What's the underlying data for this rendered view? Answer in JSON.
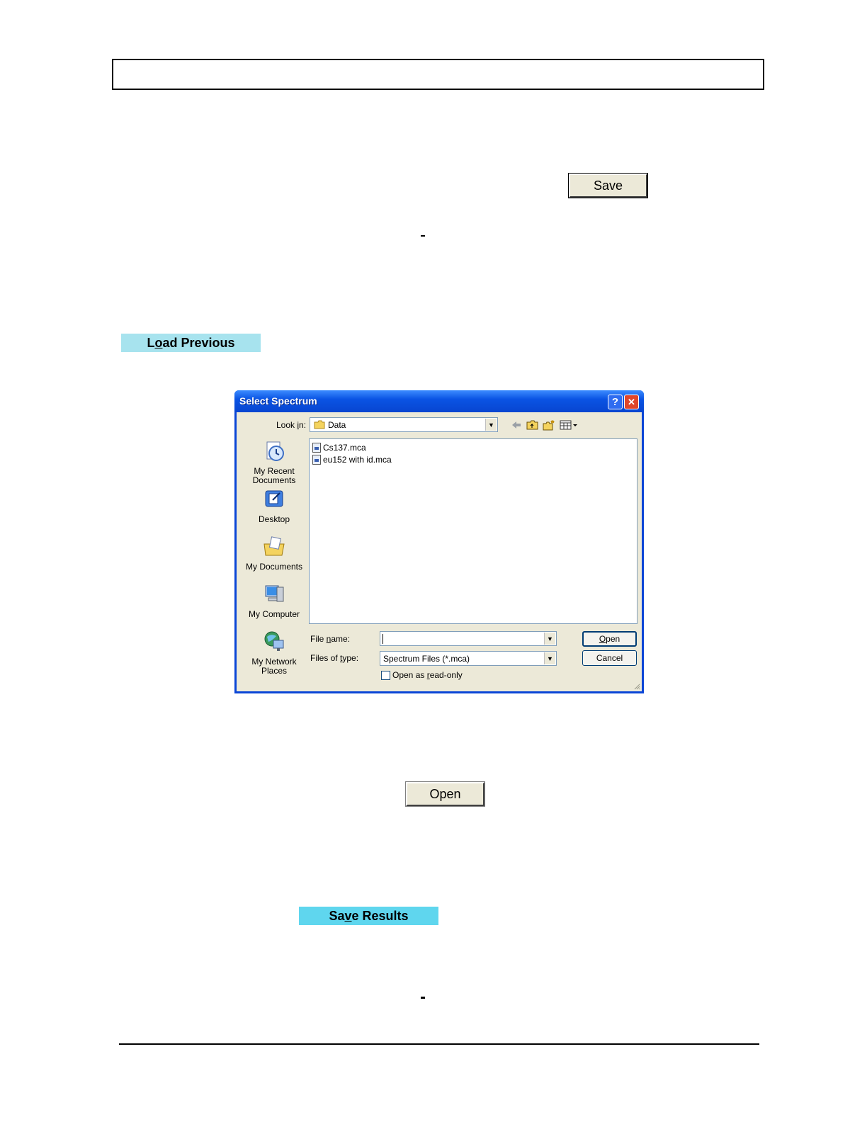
{
  "doc": {
    "save_button_label": "Save",
    "load_previous_label_pre": "L",
    "load_previous_label_ul": "o",
    "load_previous_label_post": "ad Previous",
    "open_button_label": "Open",
    "save_results_label_pre": "Sa",
    "save_results_label_ul": "v",
    "save_results_label_post": "e Results"
  },
  "dialog": {
    "title": "Select Spectrum",
    "help_glyph": "?",
    "close_glyph": "✕",
    "look_in_label_pre": "Look ",
    "look_in_label_ul": "i",
    "look_in_label_post": "n:",
    "look_in_value": "Data",
    "places": [
      {
        "label_line1": "My Recent",
        "label_line2": "Documents"
      },
      {
        "label_line1": "Desktop",
        "label_line2": ""
      },
      {
        "label_line1": "My Documents",
        "label_line2": ""
      },
      {
        "label_line1": "My Computer",
        "label_line2": ""
      },
      {
        "label_line1": "My Network",
        "label_line2": "Places"
      }
    ],
    "files": [
      "Cs137.mca",
      "eu152 with id.mca"
    ],
    "file_name_label_pre": "File ",
    "file_name_label_ul": "n",
    "file_name_label_post": "ame:",
    "file_name_value": "",
    "files_of_type_label_pre": "Files of ",
    "files_of_type_label_ul": "t",
    "files_of_type_label_post": "ype:",
    "files_of_type_value": "Spectrum Files (*.mca)",
    "read_only_label_pre": "Open as ",
    "read_only_label_ul": "r",
    "read_only_label_post": "ead-only",
    "open_label_ul": "O",
    "open_label_post": "pen",
    "cancel_label": "Cancel",
    "accent_color": "#0a45d6"
  }
}
